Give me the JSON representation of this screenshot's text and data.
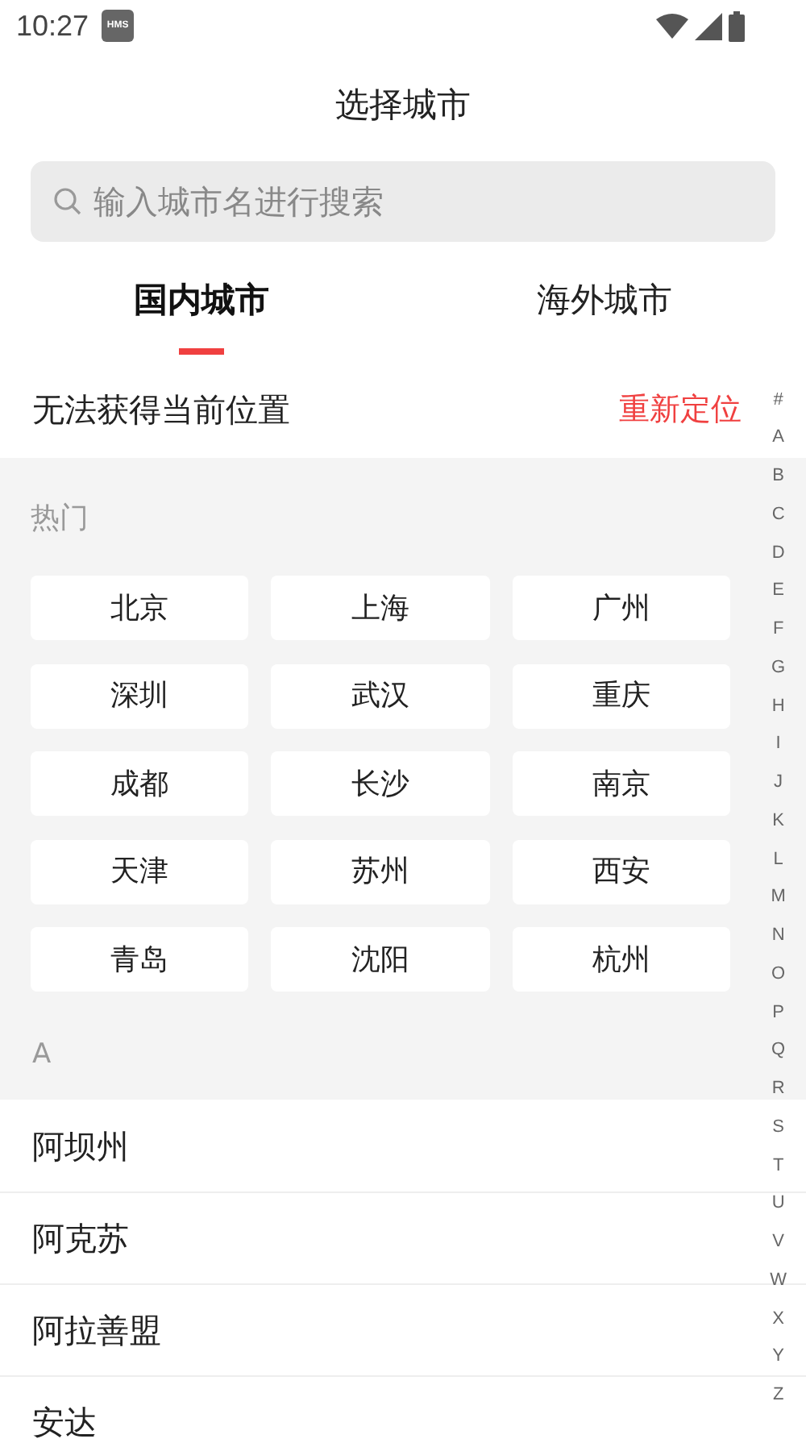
{
  "status_bar": {
    "time": "10:27",
    "badge": "HMS"
  },
  "title": "选择城市",
  "search": {
    "placeholder": "输入城市名进行搜索"
  },
  "tabs": [
    {
      "label": "国内城市",
      "selected": true
    },
    {
      "label": "海外城市",
      "selected": false
    }
  ],
  "location": {
    "message": "无法获得当前位置",
    "action": "重新定位"
  },
  "hot": {
    "heading": "热门",
    "cities": [
      "北京",
      "上海",
      "广州",
      "深圳",
      "武汉",
      "重庆",
      "成都",
      "长沙",
      "南京",
      "天津",
      "苏州",
      "西安",
      "青岛",
      "沈阳",
      "杭州"
    ]
  },
  "sections": [
    {
      "letter": "A",
      "cities": [
        "阿坝州",
        "阿克苏",
        "阿拉善盟",
        "安达"
      ]
    }
  ],
  "index_bar": [
    "#",
    "A",
    "B",
    "C",
    "D",
    "E",
    "F",
    "G",
    "H",
    "I",
    "J",
    "K",
    "L",
    "M",
    "N",
    "O",
    "P",
    "Q",
    "R",
    "S",
    "T",
    "U",
    "V",
    "W",
    "X",
    "Y",
    "Z"
  ]
}
